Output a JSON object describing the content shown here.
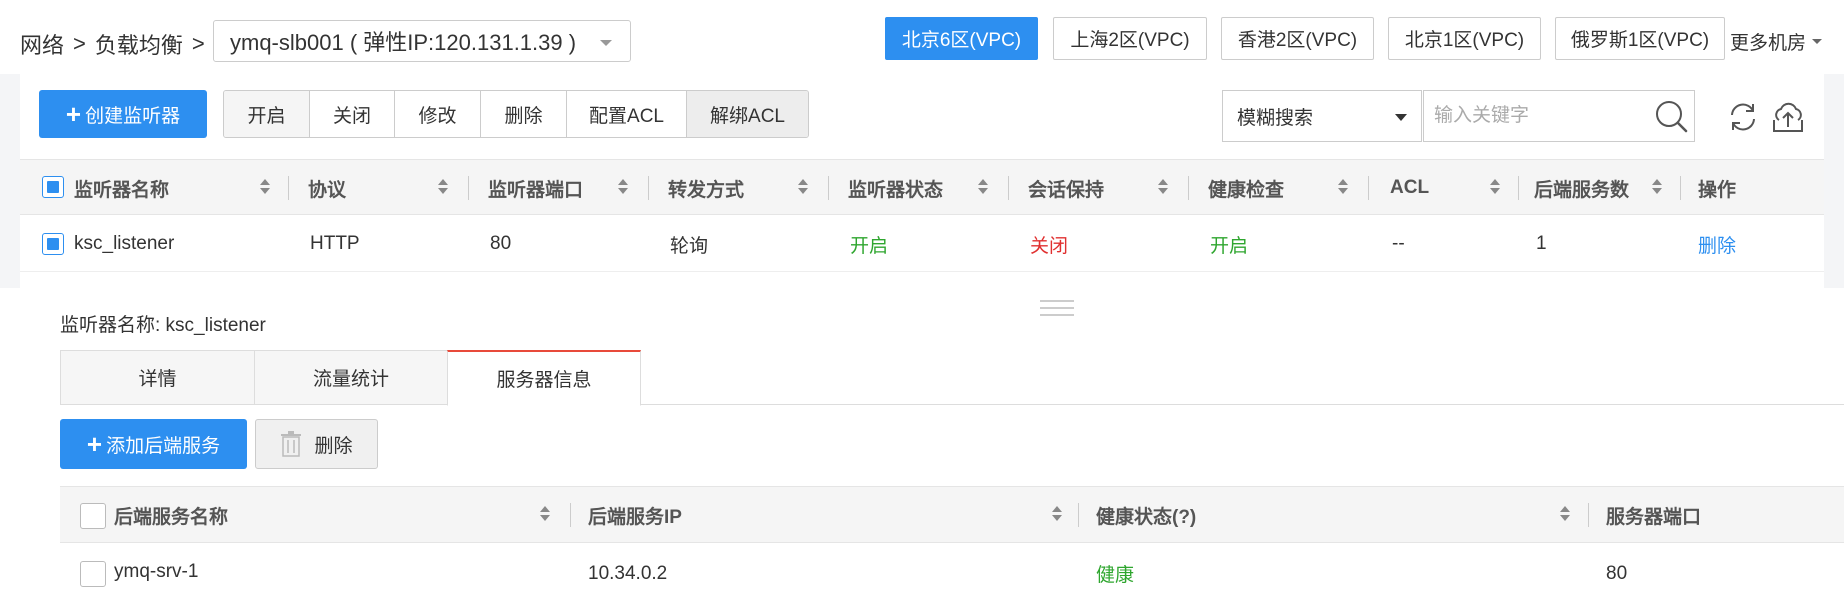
{
  "breadcrumb": {
    "item1": "网络",
    "sep": ">",
    "item2": "负载均衡"
  },
  "slb_select": {
    "value": "ymq-slb001 ( 弹性IP:120.131.1.39 )"
  },
  "regions": [
    {
      "label": "北京6区(VPC)",
      "active": true
    },
    {
      "label": "上海2区(VPC)",
      "active": false
    },
    {
      "label": "香港2区(VPC)",
      "active": false
    },
    {
      "label": "北京1区(VPC)",
      "active": false
    },
    {
      "label": "俄罗斯1区(VPC)",
      "active": false
    }
  ],
  "more_regions": "更多机房",
  "toolbar": {
    "create_label": "创建监听器",
    "buttons": [
      "开启",
      "关闭",
      "修改",
      "删除",
      "配置ACL",
      "解绑ACL"
    ],
    "search_mode": "模糊搜索",
    "search_placeholder": "输入关键字"
  },
  "listener_table": {
    "headers": [
      "监听器名称",
      "协议",
      "监听器端口",
      "转发方式",
      "监听器状态",
      "会话保持",
      "健康检查",
      "ACL",
      "后端服务数",
      "操作"
    ],
    "rows": [
      {
        "name": "ksc_listener",
        "protocol": "HTTP",
        "port": "80",
        "forward": "轮询",
        "status": "开启",
        "session": "关闭",
        "health": "开启",
        "acl": "--",
        "backend_count": "1",
        "action": "删除"
      }
    ]
  },
  "detail": {
    "title": "监听器名称: ksc_listener",
    "tabs": [
      "详情",
      "流量统计",
      "服务器信息"
    ],
    "active_tab": 2,
    "add_backend_label": "添加后端服务",
    "delete_label": "删除",
    "server_table": {
      "headers": [
        "后端服务名称",
        "后端服务IP",
        "健康状态(?)",
        "服务器端口"
      ],
      "rows": [
        {
          "name": "ymq-srv-1",
          "ip": "10.34.0.2",
          "health": "健康",
          "port": "80"
        }
      ]
    }
  },
  "colors": {
    "primary": "#2d8ff0",
    "ok": "#2fa62f",
    "bad": "#e03030",
    "tab_active": "#e84a3a"
  }
}
